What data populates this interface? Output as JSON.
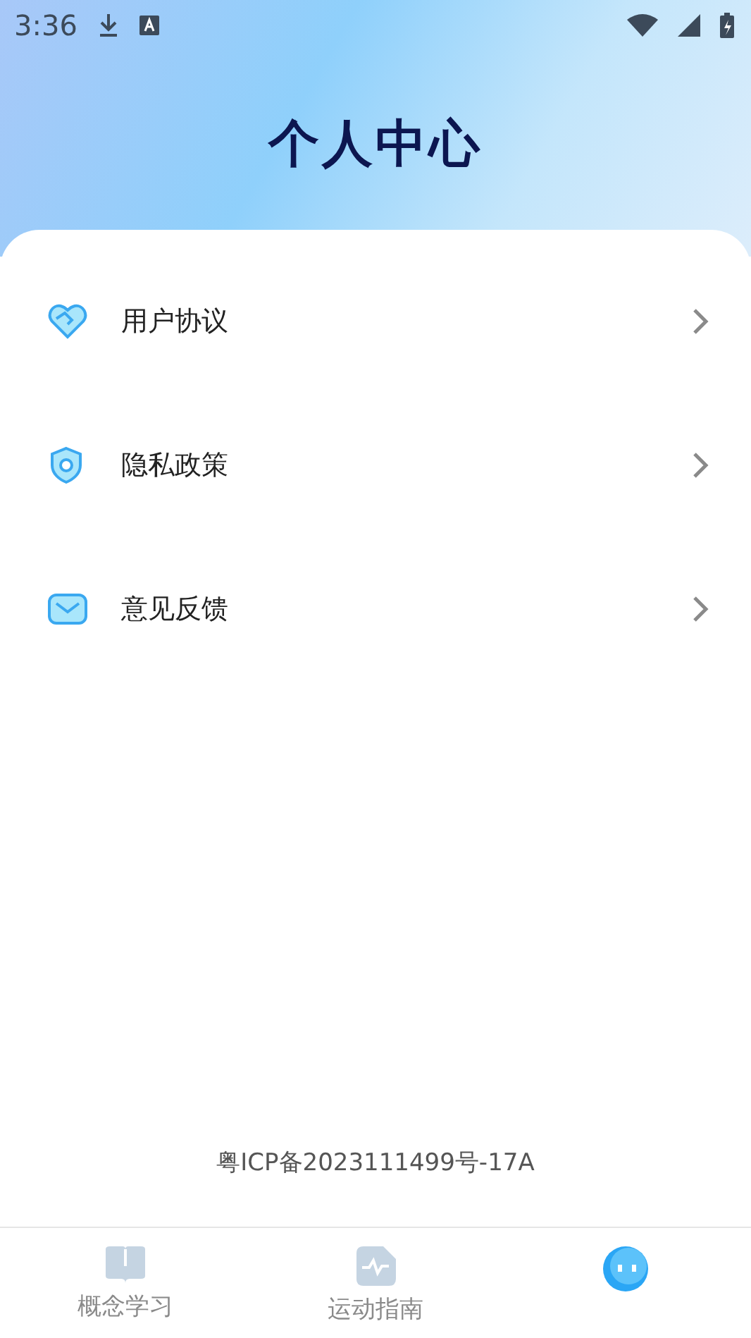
{
  "status_bar": {
    "time": "3:36"
  },
  "header": {
    "title": "个人中心"
  },
  "menu": [
    {
      "label": "用户协议"
    },
    {
      "label": "隐私政策"
    },
    {
      "label": "意见反馈"
    }
  ],
  "footer": {
    "icp": "粤ICP备2023111499号-17A"
  },
  "tabs": [
    {
      "label": "概念学习",
      "selected": false
    },
    {
      "label": "运动指南",
      "selected": false
    },
    {
      "selected": true
    }
  ]
}
